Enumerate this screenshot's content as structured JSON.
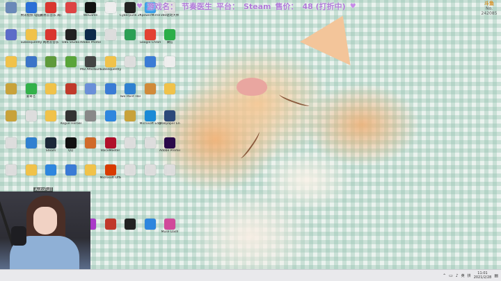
{
  "banner": {
    "game_label": "游戏名：",
    "game_value": "节奏医生",
    "platform_label": "平台：",
    "platform_value": "Steam",
    "price_label": "售价：",
    "price_value": "48 (打折中)"
  },
  "logo": {
    "name": "斗鱼",
    "room": "No. 242085"
  },
  "overlay": {
    "webcam_tag": "AutoFull"
  },
  "taskbar": {
    "lang": "英",
    "ime": "拼",
    "time": "11:01",
    "date": "2021/2/28"
  },
  "desktop_icons": [
    {
      "label": "",
      "icon": "file-icon",
      "color": "#6a89b8"
    },
    {
      "label": "腾讯视频 电脑版",
      "icon": "tencent-video-icon",
      "color": "#2a6fd6"
    },
    {
      "label": "网易云音乐 海外版",
      "icon": "netease-music-icon",
      "color": "#d9362f"
    },
    {
      "label": "",
      "icon": "app-icon",
      "color": "#d44"
    },
    {
      "label": "WeGame",
      "icon": "wegame-icon",
      "color": "#111"
    },
    {
      "label": "",
      "icon": "document-icon",
      "color": "#eee"
    },
    {
      "label": "Cyberpunk 2077",
      "icon": "cyberpunk-icon",
      "color": "#222"
    },
    {
      "label": "ApowerMirror",
      "icon": "mirror-icon",
      "color": "#3aa0e8"
    },
    {
      "label": "360驱动大师",
      "icon": "driver-icon",
      "color": "#ddd"
    },
    {
      "label": "",
      "icon": "app-icon",
      "color": "#5c6cc8"
    },
    {
      "label": "Subsequently",
      "icon": "folder-icon",
      "color": "#f0c24a"
    },
    {
      "label": "网易云音乐",
      "icon": "netease-music-icon",
      "color": "#d9362f"
    },
    {
      "label": "OBS Studio",
      "icon": "obs-icon",
      "color": "#222"
    },
    {
      "label": "Adobe Photoshop",
      "icon": "photoshop-icon",
      "color": "#0e2a4a"
    },
    {
      "label": "",
      "icon": "file-icon",
      "color": "#ddd"
    },
    {
      "label": "",
      "icon": "app-icon",
      "color": "#2b9f55"
    },
    {
      "label": "Google Chrome",
      "icon": "chrome-icon",
      "color": "#e34133"
    },
    {
      "label": "微信",
      "icon": "wechat-icon",
      "color": "#2aae48"
    },
    {
      "label": "",
      "icon": "folder-icon",
      "color": "#f0c24a"
    },
    {
      "label": "",
      "icon": "app-icon",
      "color": "#3b74c8"
    },
    {
      "label": "",
      "icon": "app-icon",
      "color": "#5e9a3a"
    },
    {
      "label": "",
      "icon": "app-icon",
      "color": "#59a53a"
    },
    {
      "label": "MSI Afterburner",
      "icon": "afterburner-icon",
      "color": "#444"
    },
    {
      "label": "Subsequently",
      "icon": "folder-icon",
      "color": "#f0c24a"
    },
    {
      "label": "",
      "icon": "file-icon",
      "color": "#ddd"
    },
    {
      "label": "",
      "icon": "app-icon",
      "color": "#3a7bd5"
    },
    {
      "label": "",
      "icon": "document-icon",
      "color": "#eee"
    },
    {
      "label": "",
      "icon": "folder-icon",
      "color": "#c8a23a"
    },
    {
      "label": "爱奇艺",
      "icon": "iqiyi-icon",
      "color": "#33b14a"
    },
    {
      "label": "",
      "icon": "folder-icon",
      "color": "#f0c24a"
    },
    {
      "label": "",
      "icon": "app-icon",
      "color": "#c0392b"
    },
    {
      "label": "",
      "icon": "app-icon",
      "color": "#6a8fd8"
    },
    {
      "label": "",
      "icon": "app-icon",
      "color": "#3a7bd5"
    },
    {
      "label": "Two Point Hospital",
      "icon": "hospital-icon",
      "color": "#2f80d0"
    },
    {
      "label": "",
      "icon": "game-icon",
      "color": "#d08a3a"
    },
    {
      "label": "",
      "icon": "folder-icon",
      "color": "#f0c24a"
    },
    {
      "label": "",
      "icon": "folder-icon",
      "color": "#c8a23a"
    },
    {
      "label": "",
      "icon": "file-icon",
      "color": "#ddd"
    },
    {
      "label": "",
      "icon": "folder-icon",
      "color": "#f0c24a"
    },
    {
      "label": "Rogue Heroes",
      "icon": "rogue-heroes-icon",
      "color": "#333"
    },
    {
      "label": "",
      "icon": "app-icon",
      "color": "#888"
    },
    {
      "label": "",
      "icon": "app-icon",
      "color": "#2e86de"
    },
    {
      "label": "",
      "icon": "folder-icon",
      "color": "#c8a23a"
    },
    {
      "label": "Microsoft Edge",
      "icon": "edge-icon",
      "color": "#1a8ad6"
    },
    {
      "label": "Wallpaper Engine",
      "icon": "wallpaper-icon",
      "color": "#2b4a7a"
    },
    {
      "label": "",
      "icon": "file-icon",
      "color": "#ddd"
    },
    {
      "label": "",
      "icon": "app-icon",
      "color": "#2f80d0"
    },
    {
      "label": "Steam",
      "icon": "steam-icon",
      "color": "#1b2838"
    },
    {
      "label": "QQ",
      "icon": "qq-icon",
      "color": "#111"
    },
    {
      "label": "",
      "icon": "app-icon",
      "color": "#d06a2a"
    },
    {
      "label": "VoiceMeeter",
      "icon": "voicemeeter-icon",
      "color": "#b0102a"
    },
    {
      "label": "",
      "icon": "file-icon",
      "color": "#ddd"
    },
    {
      "label": "",
      "icon": "file-icon",
      "color": "#ddd"
    },
    {
      "label": "Adobe Premiere",
      "icon": "premiere-icon",
      "color": "#2a0a4a"
    },
    {
      "label": "",
      "icon": "file-icon",
      "color": "#ddd"
    },
    {
      "label": "",
      "icon": "folder-icon",
      "color": "#f0c24a"
    },
    {
      "label": "",
      "icon": "app-icon",
      "color": "#2e86de"
    },
    {
      "label": "",
      "icon": "app-icon",
      "color": "#3a7bd5"
    },
    {
      "label": "",
      "icon": "folder-icon",
      "color": "#f0c24a"
    },
    {
      "label": "Microsoft Office",
      "icon": "office-icon",
      "color": "#d83b01"
    },
    {
      "label": "",
      "icon": "file-icon",
      "color": "#ddd"
    },
    {
      "label": "",
      "icon": "file-icon",
      "color": "#ddd"
    },
    {
      "label": "",
      "icon": "file-icon",
      "color": "#ddd"
    },
    {
      "label": "",
      "icon": "app-icon",
      "color": "#aa3ac8"
    },
    {
      "label": "",
      "icon": "app-icon",
      "color": "#c0392b"
    },
    {
      "label": "",
      "icon": "app-icon",
      "color": "#222"
    },
    {
      "label": "",
      "icon": "app-icon",
      "color": "#2e86de"
    },
    {
      "label": "Muse Dash",
      "icon": "muse-dash-icon",
      "color": "#d04a9a"
    }
  ]
}
